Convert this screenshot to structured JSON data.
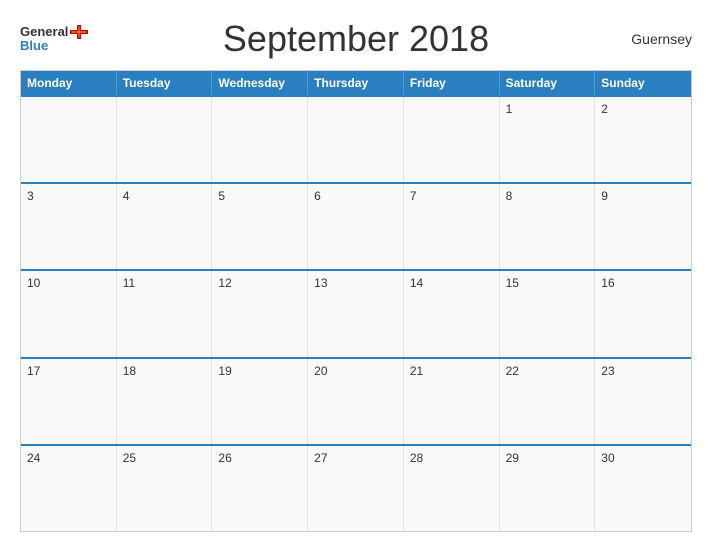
{
  "header": {
    "title": "September 2018",
    "country": "Guernsey",
    "logo_general": "General",
    "logo_blue": "Blue"
  },
  "weekdays": [
    "Monday",
    "Tuesday",
    "Wednesday",
    "Thursday",
    "Friday",
    "Saturday",
    "Sunday"
  ],
  "weeks": [
    [
      {
        "day": "",
        "empty": true
      },
      {
        "day": "",
        "empty": true
      },
      {
        "day": "",
        "empty": true
      },
      {
        "day": "",
        "empty": true
      },
      {
        "day": "",
        "empty": true
      },
      {
        "day": "1"
      },
      {
        "day": "2"
      }
    ],
    [
      {
        "day": "3"
      },
      {
        "day": "4"
      },
      {
        "day": "5"
      },
      {
        "day": "6"
      },
      {
        "day": "7"
      },
      {
        "day": "8"
      },
      {
        "day": "9"
      }
    ],
    [
      {
        "day": "10"
      },
      {
        "day": "11"
      },
      {
        "day": "12"
      },
      {
        "day": "13"
      },
      {
        "day": "14"
      },
      {
        "day": "15"
      },
      {
        "day": "16"
      }
    ],
    [
      {
        "day": "17"
      },
      {
        "day": "18"
      },
      {
        "day": "19"
      },
      {
        "day": "20"
      },
      {
        "day": "21"
      },
      {
        "day": "22"
      },
      {
        "day": "23"
      }
    ],
    [
      {
        "day": "24"
      },
      {
        "day": "25"
      },
      {
        "day": "26"
      },
      {
        "day": "27"
      },
      {
        "day": "28"
      },
      {
        "day": "29"
      },
      {
        "day": "30"
      }
    ]
  ]
}
